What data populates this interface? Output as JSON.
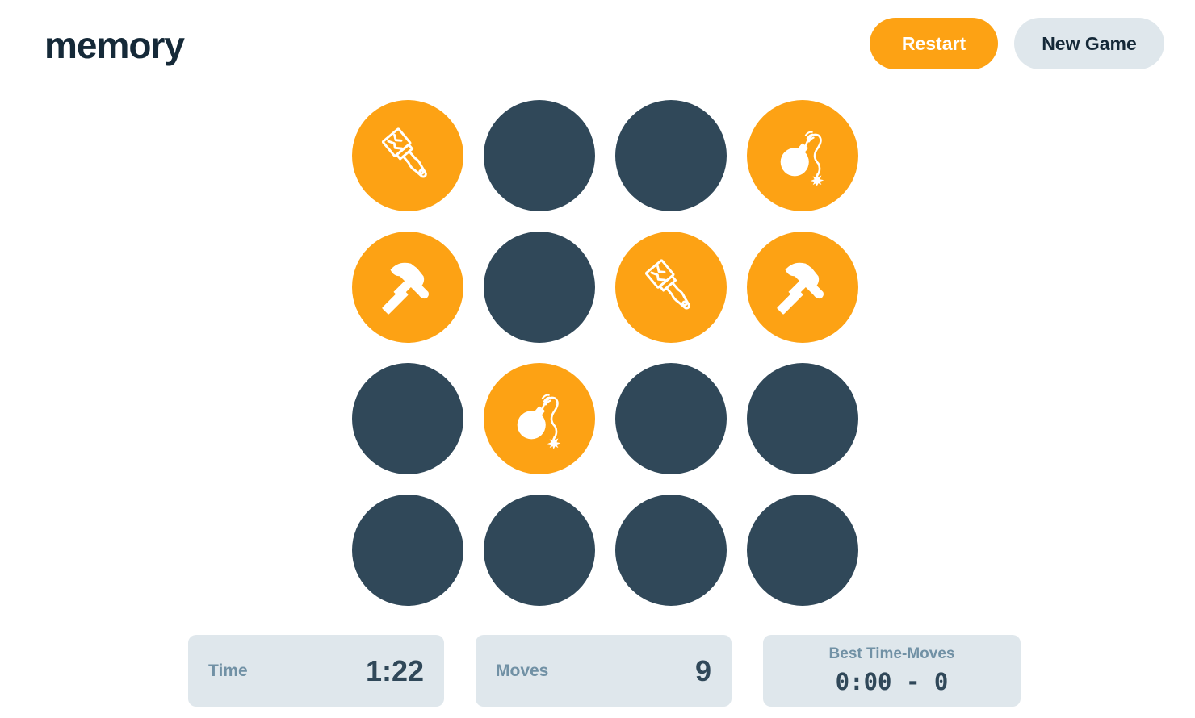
{
  "header": {
    "logo": "memory",
    "restart_label": "Restart",
    "new_game_label": "New Game"
  },
  "colors": {
    "revealed": "#FDA214",
    "hidden": "#304859",
    "panel": "#DFE7EC",
    "label": "#7191A5",
    "heading": "#152938"
  },
  "board": {
    "rows": 4,
    "columns": 4,
    "tiles": [
      {
        "state": "revealed",
        "icon": "paintbrush-icon"
      },
      {
        "state": "hidden",
        "icon": ""
      },
      {
        "state": "hidden",
        "icon": ""
      },
      {
        "state": "revealed",
        "icon": "bomb-icon"
      },
      {
        "state": "revealed",
        "icon": "hammer-icon"
      },
      {
        "state": "hidden",
        "icon": ""
      },
      {
        "state": "revealed",
        "icon": "paintbrush-icon"
      },
      {
        "state": "revealed",
        "icon": "hammer-icon"
      },
      {
        "state": "hidden",
        "icon": ""
      },
      {
        "state": "revealed",
        "icon": "bomb-icon"
      },
      {
        "state": "hidden",
        "icon": ""
      },
      {
        "state": "hidden",
        "icon": ""
      },
      {
        "state": "hidden",
        "icon": ""
      },
      {
        "state": "hidden",
        "icon": ""
      },
      {
        "state": "hidden",
        "icon": ""
      },
      {
        "state": "hidden",
        "icon": ""
      }
    ]
  },
  "stats": {
    "time_label": "Time",
    "time_value": "1:22",
    "moves_label": "Moves",
    "moves_value": "9",
    "best_label": "Best Time-Moves",
    "best_value": "0:00 - 0"
  }
}
